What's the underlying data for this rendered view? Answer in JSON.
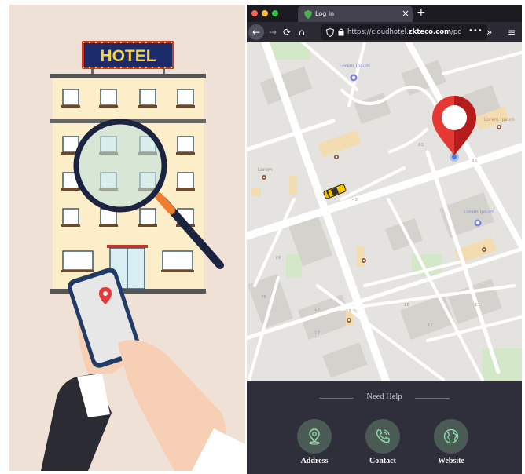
{
  "illustration": {
    "hotel_sign": "HOTEL"
  },
  "browser": {
    "tab_title": "Log in",
    "url_prefix": "https://cloudhotel.",
    "url_domain": "zkteco.com",
    "url_suffix": "/po"
  },
  "map": {
    "labels": [
      "Lorem ipsum",
      "Lorem ipsum",
      "Lorem",
      "Lorem ipsum"
    ],
    "street_numbers": [
      "83",
      "38",
      "43",
      "79",
      "76",
      "13",
      "15",
      "12",
      "18",
      "11",
      "12"
    ]
  },
  "footer": {
    "need_help": "Need Help",
    "buttons": [
      {
        "label": "Address",
        "icon": "location-pin-icon"
      },
      {
        "label": "Contact",
        "icon": "phone-icon"
      },
      {
        "label": "Website",
        "icon": "globe-icon"
      }
    ]
  },
  "colors": {
    "pin_red": "#e53935",
    "accent_green": "#8fd3a6",
    "footer_bg": "#2f2f3c",
    "sign_blue": "#1b2a6b",
    "sign_yellow": "#f8d33a"
  }
}
